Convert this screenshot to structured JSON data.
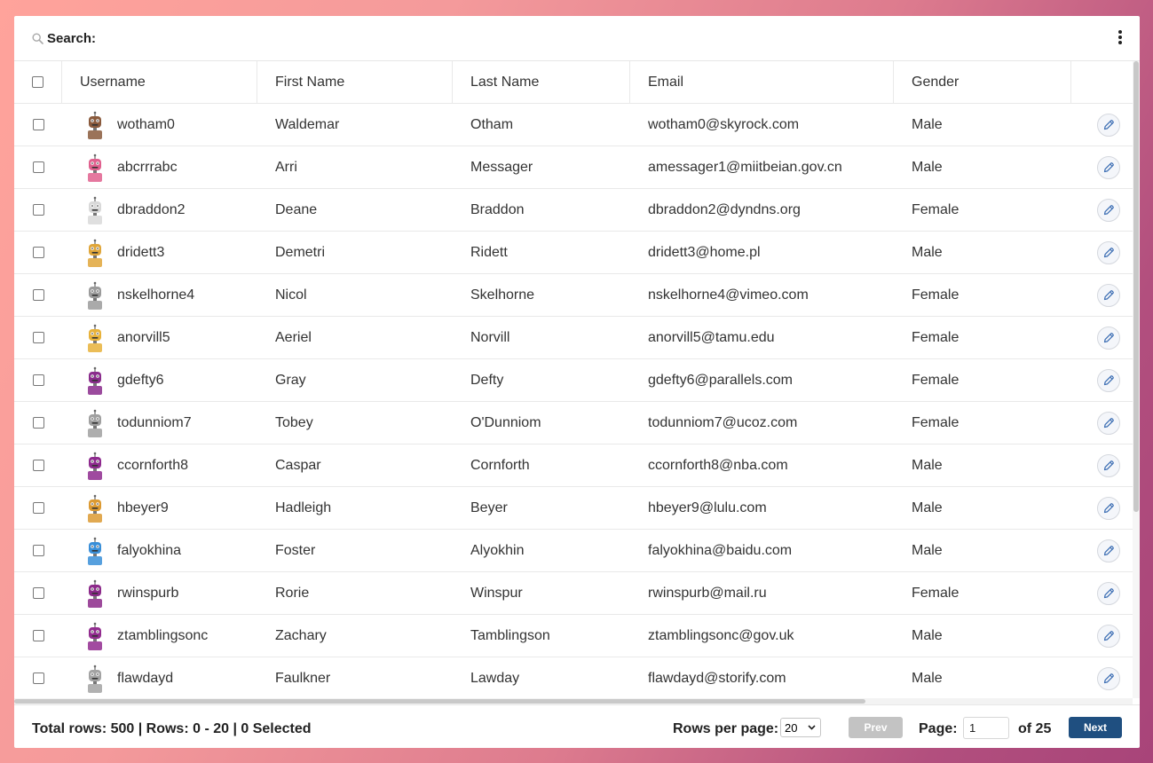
{
  "search": {
    "label": "Search:"
  },
  "columns": {
    "username": "Username",
    "first_name": "First Name",
    "last_name": "Last Name",
    "email": "Email",
    "gender": "Gender"
  },
  "rows": [
    {
      "username": "wotham0",
      "first_name": "Waldemar",
      "last_name": "Otham",
      "email": "wotham0@skyrock.com",
      "gender": "Male",
      "avatar_color": "#8a5a3c"
    },
    {
      "username": "abcrrrabc",
      "first_name": "Arri",
      "last_name": "Messager",
      "email": "amessager1@miitbeian.gov.cn",
      "gender": "Male",
      "avatar_color": "#e0608e"
    },
    {
      "username": "dbraddon2",
      "first_name": "Deane",
      "last_name": "Braddon",
      "email": "dbraddon2@dyndns.org",
      "gender": "Female",
      "avatar_color": "#d9d9d9"
    },
    {
      "username": "dridett3",
      "first_name": "Demetri",
      "last_name": "Ridett",
      "email": "dridett3@home.pl",
      "gender": "Male",
      "avatar_color": "#e0a63a"
    },
    {
      "username": "nskelhorne4",
      "first_name": "Nicol",
      "last_name": "Skelhorne",
      "email": "nskelhorne4@vimeo.com",
      "gender": "Female",
      "avatar_color": "#9b9b9b"
    },
    {
      "username": "anorvill5",
      "first_name": "Aeriel",
      "last_name": "Norvill",
      "email": "anorvill5@tamu.edu",
      "gender": "Female",
      "avatar_color": "#e8b23a"
    },
    {
      "username": "gdefty6",
      "first_name": "Gray",
      "last_name": "Defty",
      "email": "gdefty6@parallels.com",
      "gender": "Female",
      "avatar_color": "#8a2c8c"
    },
    {
      "username": "todunniom7",
      "first_name": "Tobey",
      "last_name": "O'Dunniom",
      "email": "todunniom7@ucoz.com",
      "gender": "Female",
      "avatar_color": "#a0a0a0"
    },
    {
      "username": "ccornforth8",
      "first_name": "Caspar",
      "last_name": "Cornforth",
      "email": "ccornforth8@nba.com",
      "gender": "Male",
      "avatar_color": "#8e2a8e"
    },
    {
      "username": "hbeyer9",
      "first_name": "Hadleigh",
      "last_name": "Beyer",
      "email": "hbeyer9@lulu.com",
      "gender": "Male",
      "avatar_color": "#dc9a32"
    },
    {
      "username": "falyokhina",
      "first_name": "Foster",
      "last_name": "Alyokhin",
      "email": "falyokhina@baidu.com",
      "gender": "Male",
      "avatar_color": "#3a8fd8"
    },
    {
      "username": "rwinspurb",
      "first_name": "Rorie",
      "last_name": "Winspur",
      "email": "rwinspurb@mail.ru",
      "gender": "Female",
      "avatar_color": "#8c2a8a"
    },
    {
      "username": "ztamblingsonc",
      "first_name": "Zachary",
      "last_name": "Tamblingson",
      "email": "ztamblingsonc@gov.uk",
      "gender": "Male",
      "avatar_color": "#922c8f"
    },
    {
      "username": "flawdayd",
      "first_name": "Faulkner",
      "last_name": "Lawday",
      "email": "flawdayd@storify.com",
      "gender": "Male",
      "avatar_color": "#a3a3a3"
    }
  ],
  "footer": {
    "status": "Total rows: 500 | Rows: 0 - 20 | 0 Selected",
    "rows_per_page_label": "Rows per page:",
    "rows_per_page_value": "20",
    "prev_label": "Prev",
    "page_label": "Page:",
    "page_value": "1",
    "of_label": "of 25",
    "next_label": "Next"
  },
  "colors": {
    "next_button": "#1f4f80",
    "prev_button_disabled": "#c3c3c3",
    "edit_icon": "#3b6db3"
  },
  "icons": {
    "search": "search-icon",
    "menu": "kebab-menu-icon",
    "edit": "pencil-icon",
    "dropdown": "chevron-down-icon"
  }
}
